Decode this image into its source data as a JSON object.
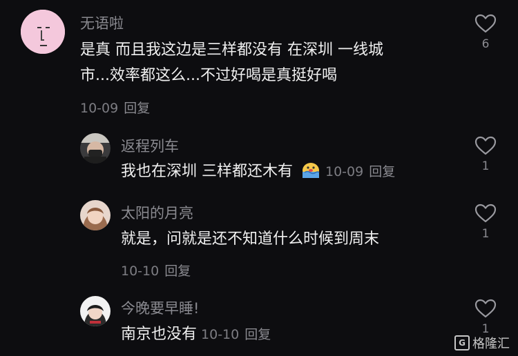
{
  "comments": [
    {
      "username": "无语啦",
      "text_line1": "是真 而且我这边是三样都没有 在深圳 一线城",
      "text_line2": "市...效率都这么...不过好喝是真挺好喝",
      "date": "10-09",
      "reply_label": "回复",
      "likes": "6"
    },
    {
      "username": "返程列车",
      "text": "我也在深圳 三样都还木有",
      "date": "10-09",
      "reply_label": "回复",
      "likes": "1"
    },
    {
      "username": "太阳的月亮",
      "text": "就是，问就是还不知道什么时候到周末",
      "date": "10-10",
      "reply_label": "回复",
      "likes": "1"
    },
    {
      "username": "今晚要早睡!",
      "text": "南京也没有",
      "date": "10-10",
      "reply_label": "回复",
      "likes": "1"
    }
  ],
  "watermark": {
    "logo": "G",
    "text": "格隆汇"
  },
  "colors": {
    "background": "#0d0d10",
    "username": "#8a8a90",
    "text": "#f0f0f0",
    "meta": "#7d7d83"
  }
}
